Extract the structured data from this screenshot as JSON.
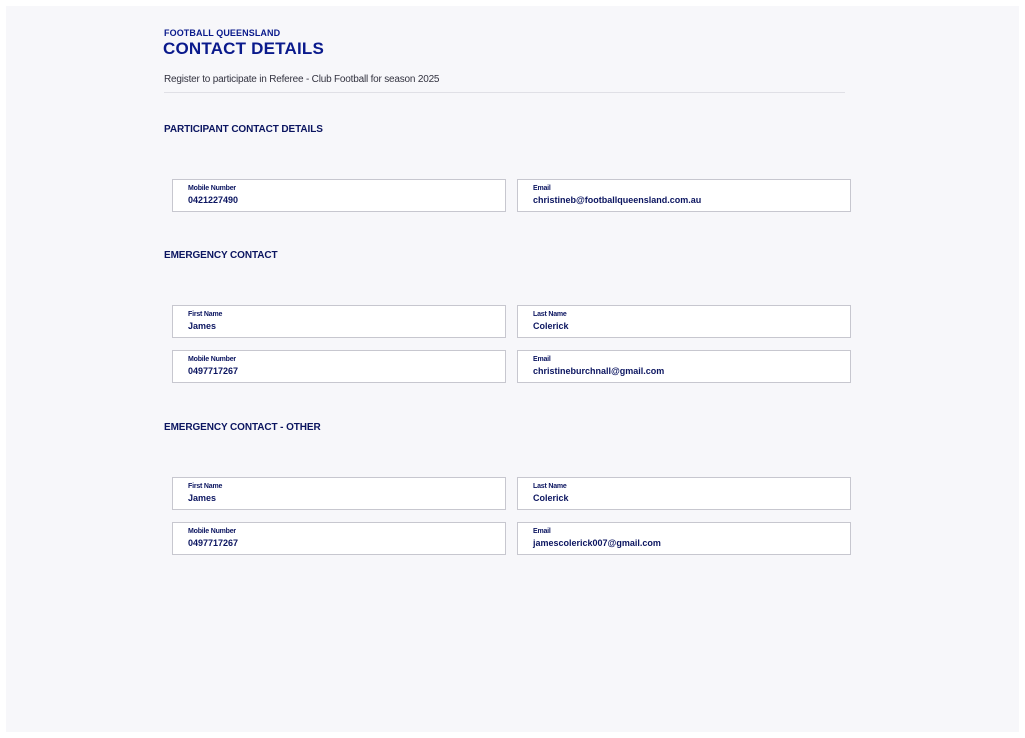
{
  "header": {
    "org": "FOOTBALL QUEENSLAND",
    "title": "CONTACT DETAILS",
    "subtitle": "Register to participate in Referee - Club Football for season 2025"
  },
  "participant": {
    "heading": "PARTICIPANT CONTACT DETAILS",
    "mobile_label": "Mobile Number",
    "mobile_value": "0421227490",
    "email_label": "Email",
    "email_value": "christineb@footballqueensland.com.au"
  },
  "emergency": {
    "heading": "EMERGENCY CONTACT",
    "first_name_label": "First Name",
    "first_name_value": "James",
    "last_name_label": "Last Name",
    "last_name_value": "Colerick",
    "mobile_label": "Mobile Number",
    "mobile_value": "0497717267",
    "email_label": "Email",
    "email_value": "christineburchnall@gmail.com"
  },
  "emergency_other": {
    "heading": "EMERGENCY CONTACT - OTHER",
    "first_name_label": "First Name",
    "first_name_value": "James",
    "last_name_label": "Last Name",
    "last_name_value": "Colerick",
    "mobile_label": "Mobile Number",
    "mobile_value": "0497717267",
    "email_label": "Email",
    "email_value": "jamescolerick007@gmail.com"
  }
}
